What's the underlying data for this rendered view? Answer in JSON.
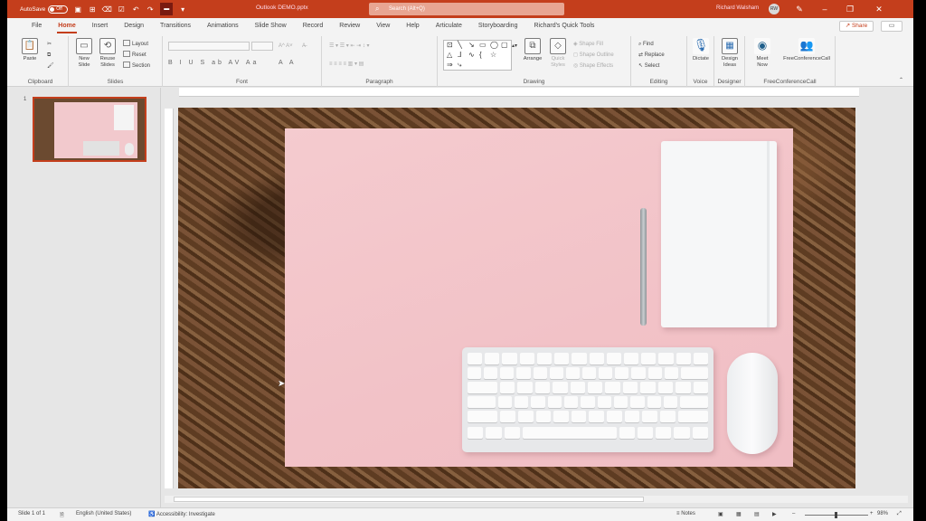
{
  "titlebar": {
    "autosave_label": "AutoSave",
    "autosave_state": "Off",
    "filename": "Outlook DEMO.pptx",
    "search_placeholder": "Search (Alt+Q)",
    "user_name": "Richard Walsham",
    "user_initials": "RW",
    "accent_color": "#c43e1c"
  },
  "tabs": [
    "File",
    "Home",
    "Insert",
    "Design",
    "Transitions",
    "Animations",
    "Slide Show",
    "Record",
    "Review",
    "View",
    "Help",
    "Articulate",
    "Storyboarding",
    "Richard's Quick Tools"
  ],
  "active_tab": "Home",
  "share_label": "Share",
  "ribbon": {
    "clipboard": {
      "name": "Clipboard",
      "paste": "Paste"
    },
    "slides": {
      "name": "Slides",
      "new_slide": "New Slide",
      "reuse_slides": "Reuse Slides",
      "layout": "Layout",
      "reset": "Reset",
      "section": "Section"
    },
    "font": {
      "name": "Font",
      "format_row": "B I U S ab AV Aa",
      "color_row": "A A"
    },
    "paragraph": {
      "name": "Paragraph"
    },
    "drawing": {
      "name": "Drawing",
      "arrange": "Arrange",
      "quick_styles": "Quick Styles",
      "shape_fill": "Shape Fill",
      "shape_outline": "Shape Outline",
      "shape_effects": "Shape Effects"
    },
    "editing": {
      "name": "Editing",
      "find": "Find",
      "replace": "Replace",
      "select": "Select"
    },
    "voice": {
      "name": "Voice",
      "dictate": "Dictate"
    },
    "designer": {
      "name": "Designer",
      "design_ideas": "Design Ideas"
    },
    "freeconference": {
      "name": "FreeConferenceCall",
      "meet_now": "Meet Now",
      "fcc": "FreeConferenceCall"
    }
  },
  "slides_panel": {
    "slide_number": "1"
  },
  "status": {
    "slide_info": "Slide 1 of 1",
    "language": "English (United States)",
    "accessibility": "Accessibility: Investigate",
    "notes": "Notes",
    "zoom": "98%"
  }
}
